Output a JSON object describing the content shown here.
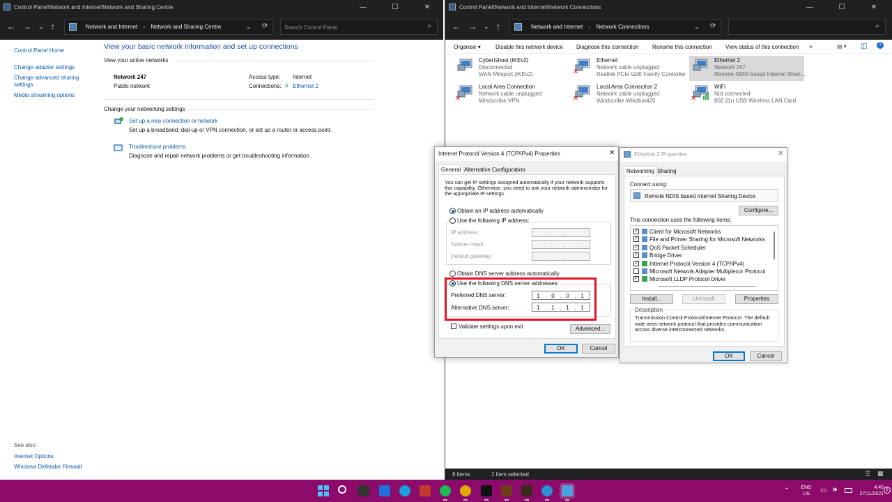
{
  "left_window": {
    "title": "Control Panel\\Network and Internet\\Network and Sharing Centre",
    "breadcrumbs": [
      "Network and Internet",
      "Network and Sharing Centre"
    ],
    "search_placeholder": "Search Control Panel",
    "side_links": [
      "Control Panel Home",
      "Change adapter settings",
      "Change advanced sharing settings",
      "Media streaming options"
    ],
    "heading": "View your basic network information and set up connections",
    "active_label": "View your active networks",
    "network_name": "Network 247",
    "network_type": "Public network",
    "access_label": "Access type:",
    "access_value": "Internet",
    "connections_label": "Connections:",
    "connections_value": "Ethernet 2",
    "change_label": "Change your networking settings",
    "setup_link": "Set up a new connection or network",
    "setup_desc": "Set up a broadband, dial-up or VPN connection, or set up a router or access point.",
    "trouble_link": "Troubleshoot problems",
    "trouble_desc": "Diagnose and repair network problems or get troubleshooting information.",
    "see_also": "See also",
    "see_also_links": [
      "Internet Options",
      "Windows Defender Firewall"
    ]
  },
  "right_window": {
    "title": "Control Panel\\Network and Internet\\Network Connections",
    "breadcrumbs": [
      "Network and Internet",
      "Network Connections"
    ],
    "toolbar": [
      "Organise",
      "Disable this network device",
      "Diagnose this connection",
      "Rename this connection",
      "View status of this connection"
    ],
    "more": "»",
    "connections": [
      {
        "name": "CyberGhost (IKEv2)",
        "status": "Disconnected",
        "device": "WAN Miniport (IKEv2)",
        "x_mark": false,
        "selected": false
      },
      {
        "name": "Ethernet",
        "status": "Network cable unplugged",
        "device": "Realtek PCIe GbE Family Controller",
        "x_mark": true,
        "selected": false
      },
      {
        "name": "Ethernet 2",
        "status": "Network 247",
        "device": "Remote NDIS based Internet Shari...",
        "x_mark": false,
        "selected": true
      },
      {
        "name": "Local Area Connection",
        "status": "Network cable unplugged",
        "device": "Windscribe VPN",
        "x_mark": true,
        "selected": false
      },
      {
        "name": "Local Area Connection 2",
        "status": "Network cable unplugged",
        "device": "Windscribe Windtun420",
        "x_mark": true,
        "selected": false
      },
      {
        "name": "WiFi",
        "status": "Not connected",
        "device": "802.11n USB Wireless LAN Card",
        "x_mark": true,
        "selected": false
      }
    ],
    "status_items": "6 items",
    "status_selected": "1 item selected"
  },
  "ipv4_dialog": {
    "title": "Internet Protocol Version 4 (TCP/IPv4) Properties",
    "tabs": [
      "General",
      "Alternative Configuration"
    ],
    "intro": "You can get IP settings assigned automatically if your network supports this capability. Otherwise, you need to ask your network administrator for the appropriate IP settings.",
    "obtain_ip": "Obtain an IP address automatically",
    "use_ip": "Use the following IP address:",
    "ip_label": "IP address:",
    "subnet_label": "Subnet mask:",
    "gateway_label": "Default gateway:",
    "obtain_dns": "Obtain DNS server address automatically",
    "use_dns": "Use the following DNS server addresses:",
    "preferred_label": "Preferred DNS server:",
    "preferred_value": [
      "1",
      "0",
      "0",
      "1"
    ],
    "alternate_label": "Alternative DNS server:",
    "alternate_value": [
      "1",
      "1",
      "1",
      "1"
    ],
    "validate": "Validate settings upon exit",
    "advanced": "Advanced...",
    "ok": "OK",
    "cancel": "Cancel",
    "dot": "."
  },
  "eth_dialog": {
    "title": "Ethernet 2 Properties",
    "tabs": [
      "Networking",
      "Sharing"
    ],
    "connect_using": "Connect using:",
    "adapter": "Remote NDIS based Internet Sharing Device",
    "configure": "Configure...",
    "items_label": "This connection uses the following items:",
    "items": [
      {
        "label": "Client for Microsoft Networks",
        "checked": true
      },
      {
        "label": "File and Printer Sharing for Microsoft Networks",
        "checked": true
      },
      {
        "label": "QoS Packet Scheduler",
        "checked": true
      },
      {
        "label": "Bridge Driver",
        "checked": true
      },
      {
        "label": "Internet Protocol Version 4 (TCP/IPv4)",
        "checked": true
      },
      {
        "label": "Microsoft Network Adapter Multiplexor Protocol",
        "checked": false
      },
      {
        "label": "Microsoft LLDP Protocol Driver",
        "checked": true
      }
    ],
    "install": "Install...",
    "uninstall": "Uninstall",
    "properties": "Properties",
    "description_label": "Description",
    "description": "Transmission Control Protocol/Internet Protocol. The default wide area network protocol that provides communication across diverse interconnected networks.",
    "ok": "OK",
    "cancel": "Cancel"
  },
  "taskbar": {
    "lang": "ENG",
    "region": "US",
    "time": "4:40",
    "date": "27/11/2021",
    "notif": "5",
    "apps": [
      "start-icon",
      "search-icon",
      "task-view-icon",
      "widgets-icon",
      "edge-icon",
      "pinwheel-icon",
      "spotify-icon",
      "chrome-icon",
      "terminal-icon",
      "game-icon",
      "game2-icon",
      "globe-icon",
      "network-settings-icon"
    ],
    "colors": {
      "taskbar": "#8b0a6a",
      "accent": "#0078d7",
      "highlight": "#e81123"
    }
  }
}
